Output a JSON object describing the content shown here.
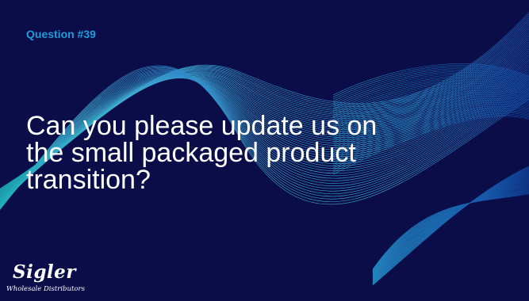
{
  "slide": {
    "question_number": "Question #39",
    "question_lines": [
      "Can you please update us on",
      "the small packaged product",
      "transition?"
    ]
  },
  "logo": {
    "name": "Sigler",
    "tagline": "Wholesale Distributors"
  },
  "colors": {
    "background": "#0a0d48",
    "accent": "#1f9cdc",
    "wave_light": "#7fe3f0",
    "wave_dark": "#0e4fb0",
    "text": "#ffffff"
  }
}
